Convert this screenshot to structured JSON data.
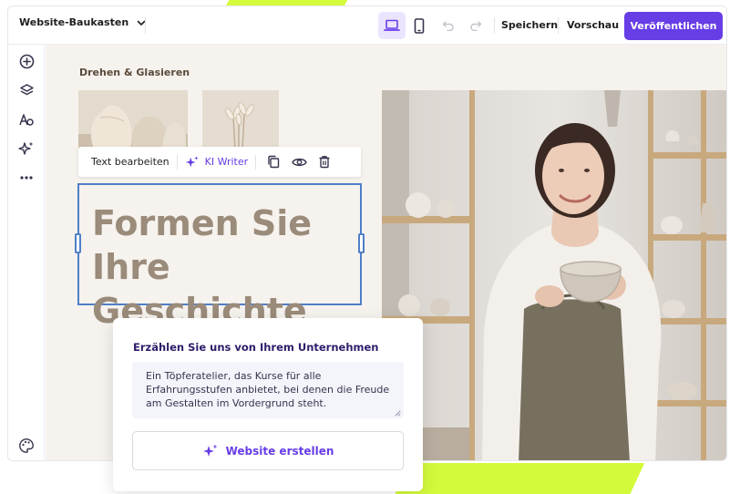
{
  "topbar": {
    "app_name": "Website-Baukasten",
    "save_label": "Speichern",
    "preview_label": "Vorschau",
    "publish_label": "Veröffentlichen"
  },
  "editor": {
    "section_title": "Drehen & Glasieren",
    "toolbar": {
      "edit_text_label": "Text bearbeiten",
      "ai_writer_label": "KI Writer"
    },
    "heading": {
      "line1": "Formen Sie Ihre",
      "line2": "Geschichte"
    }
  },
  "dialog": {
    "title": "Erzählen Sie uns von Ihrem Unternehmen",
    "description": "Ein Töpferatelier, das Kurse für alle Erfahrungsstufen anbietet, bei denen die Freude am Gestalten im Vordergrund steht.",
    "create_button_label": "Website erstellen"
  },
  "colors": {
    "brand_purple": "#673de6",
    "lime_accent": "#d4fa3c",
    "selection_blue": "#4f7fc7",
    "heading_taupe": "#9a8b7a",
    "canvas_bg": "#f6f2ee"
  },
  "icons": {
    "app_switch": "chevron-down-icon",
    "device_desktop": "laptop-icon",
    "device_mobile": "smartphone-icon",
    "undo": "undo-icon",
    "redo": "redo-icon",
    "rail": [
      "add-circle-icon",
      "layers-icon",
      "typography-icon",
      "ai-sparkle-icon",
      "more-dots-icon",
      "palette-icon"
    ],
    "toolbar": [
      "ai-sparkle-icon",
      "duplicate-icon",
      "visibility-eye-icon",
      "trash-icon"
    ],
    "dialog_button": "ai-sparkle-icon"
  }
}
